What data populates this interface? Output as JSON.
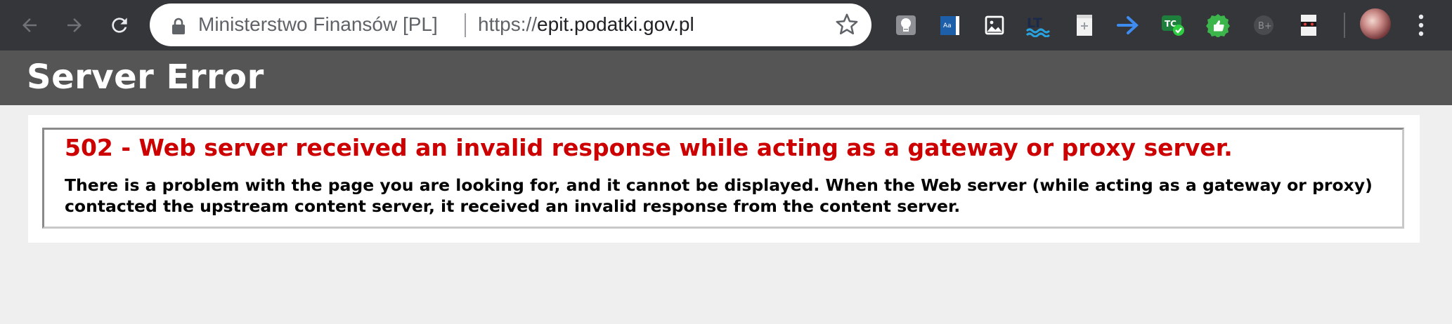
{
  "browser": {
    "site_identity": "Ministerstwo Finansów [PL]",
    "url_scheme": "https://",
    "url_host": "epit.podatki.gov.pl",
    "colors": {
      "toolbar_bg": "#35363a",
      "omnibox_bg": "#ffffff"
    },
    "extensions": [
      "lightbulb-icon",
      "dictionary-icon",
      "image-icon",
      "languagetool-icon",
      "page-add-icon",
      "arrow-forward-extension-icon",
      "grammarly-check-icon",
      "thumbs-up-icon",
      "b-plus-icon",
      "masked-document-icon"
    ]
  },
  "page": {
    "header_title": "Server Error",
    "error_title": "502 - Web server received an invalid response while acting as a gateway or proxy server.",
    "error_message": "There is a problem with the page you are looking for, and it cannot be displayed. When the Web server (while acting as a gateway or proxy) contacted the upstream content server, it received an invalid response from the content server.",
    "colors": {
      "header_bg": "#555555",
      "error_title": "#cc0000",
      "page_bg": "#eeefee"
    }
  }
}
